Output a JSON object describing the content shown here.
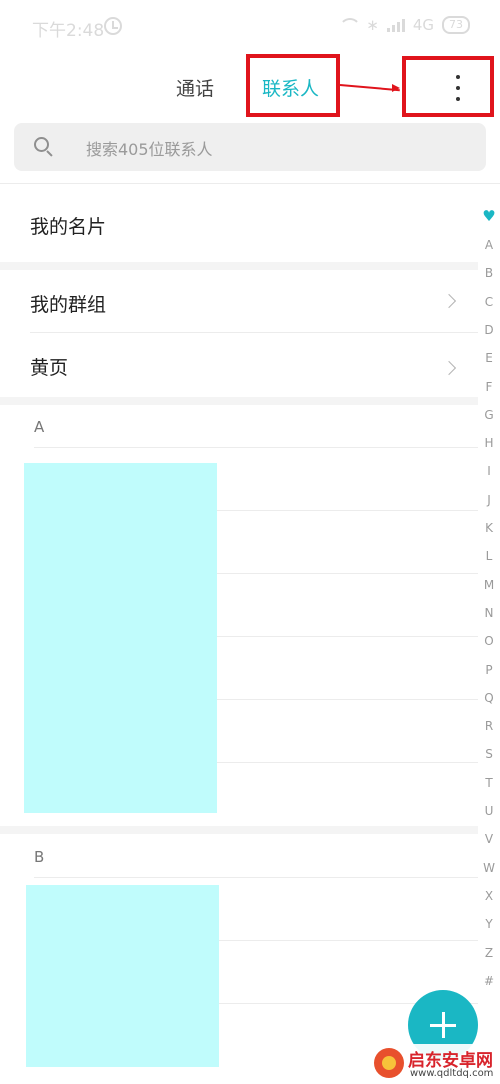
{
  "status_bar": {
    "time": "下午2:48",
    "network": "4G",
    "battery": "73",
    "icons": [
      "alarm-icon",
      "wifi-icon",
      "bluetooth-icon",
      "signal-icon",
      "battery-icon"
    ]
  },
  "tabs": [
    {
      "label": "通话",
      "active": false
    },
    {
      "label": "联系人",
      "active": true
    }
  ],
  "toolbar": {
    "more_icon": "more-vertical-icon"
  },
  "search": {
    "placeholder": "搜索405位联系人",
    "icon": "search-icon"
  },
  "rows": {
    "my_card": "我的名片",
    "my_groups": "我的群组",
    "yellow_pages": "黄页"
  },
  "sections": [
    {
      "letter": "A"
    },
    {
      "letter": "B"
    }
  ],
  "index_bar": [
    "A",
    "B",
    "C",
    "D",
    "E",
    "F",
    "G",
    "H",
    "I",
    "J",
    "K",
    "L",
    "M",
    "N",
    "O",
    "P",
    "Q",
    "R",
    "S",
    "T",
    "U",
    "V",
    "W",
    "X",
    "Y",
    "Z",
    "#"
  ],
  "colors": {
    "accent": "#1ab7c4",
    "highlight": "#e0141c",
    "redaction": "#c0fcfc"
  },
  "watermark": {
    "title": "启东安卓网",
    "url": "www.qdltdq.com"
  }
}
